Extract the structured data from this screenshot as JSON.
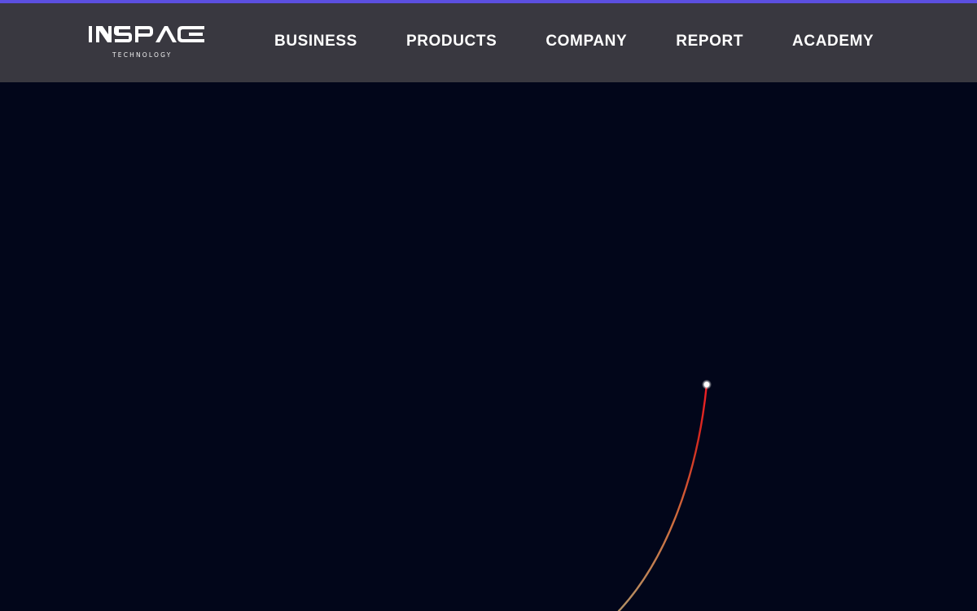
{
  "brand": {
    "name": "INSPACE",
    "tagline": "TECHNOLOGY",
    "accent_color": "#5b4fe0",
    "header_color": "#393840",
    "background_color": "#02061a"
  },
  "nav": {
    "items": [
      {
        "label": "BUSINESS"
      },
      {
        "label": "PRODUCTS"
      },
      {
        "label": "COMPANY"
      },
      {
        "label": "REPORT"
      },
      {
        "label": "ACADEMY"
      }
    ]
  },
  "hero": {
    "trail_icon": "rocket-launch-trail"
  }
}
